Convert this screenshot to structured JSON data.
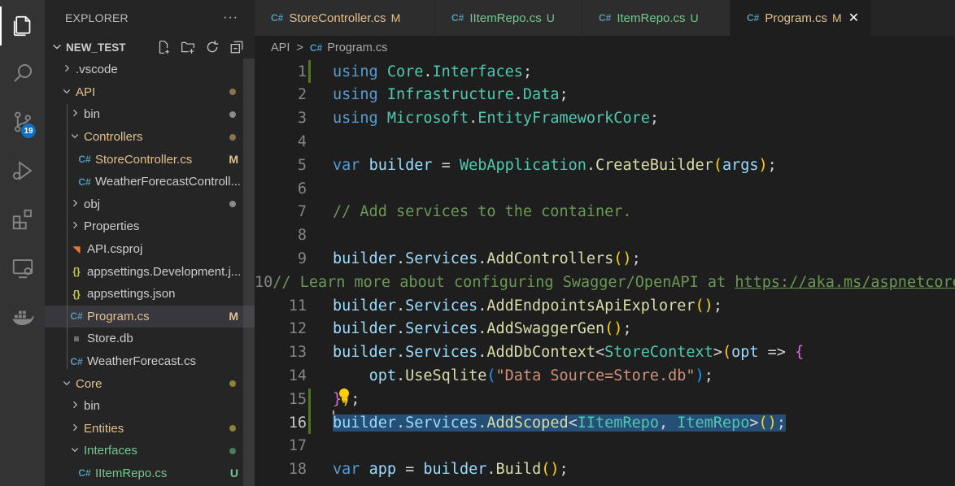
{
  "activity_bar": {
    "items": [
      {
        "icon": "explorer-icon"
      },
      {
        "icon": "search-icon"
      },
      {
        "icon": "source-control-icon",
        "badge": "19"
      },
      {
        "icon": "run-debug-icon"
      },
      {
        "icon": "extensions-icon"
      },
      {
        "icon": "remote-explorer-icon"
      },
      {
        "icon": "docker-icon"
      }
    ]
  },
  "sidebar": {
    "title": "EXPLORER",
    "more": "···",
    "project": "NEW_TEST",
    "tree": [
      {
        "label": ".vscode",
        "type": "folder",
        "expanded": false,
        "color": "#cccccc"
      },
      {
        "label": "API",
        "type": "folder",
        "expanded": true,
        "color": "#e2c08d",
        "marker": "dot",
        "marker_color": "#8a7453"
      },
      {
        "label": "bin",
        "type": "folder",
        "expanded": false,
        "color": "#cccccc",
        "marker": "dot",
        "marker_color": "#8b8b8b"
      },
      {
        "label": "Controllers",
        "type": "folder",
        "expanded": true,
        "color": "#e2c08d",
        "marker": "dot",
        "marker_color": "#8a7453"
      },
      {
        "label": "StoreController.cs",
        "type": "cs",
        "color": "#e2c08d",
        "status": "M"
      },
      {
        "label": "WeatherForecastControll...",
        "type": "cs",
        "color": "#cccccc"
      },
      {
        "label": "obj",
        "type": "folder",
        "expanded": false,
        "color": "#cccccc",
        "marker": "dot",
        "marker_color": "#8b8b8b"
      },
      {
        "label": "Properties",
        "type": "folder",
        "expanded": false,
        "color": "#cccccc"
      },
      {
        "label": "API.csproj",
        "type": "rss",
        "color": "#cccccc"
      },
      {
        "label": "appsettings.Development.j...",
        "type": "json",
        "color": "#cccccc"
      },
      {
        "label": "appsettings.json",
        "type": "json",
        "color": "#cccccc"
      },
      {
        "label": "Program.cs",
        "type": "cs",
        "color": "#e2c08d",
        "status": "M",
        "selected": true
      },
      {
        "label": "Store.db",
        "type": "db",
        "color": "#cccccc"
      },
      {
        "label": "WeatherForecast.cs",
        "type": "cs",
        "color": "#cccccc"
      },
      {
        "label": "Core",
        "type": "folder",
        "expanded": true,
        "color": "#e2c08d",
        "marker": "dot",
        "marker_color": "#8d8338"
      },
      {
        "label": "bin",
        "type": "folder",
        "expanded": false,
        "color": "#cccccc"
      },
      {
        "label": "Entities",
        "type": "folder",
        "expanded": false,
        "color": "#e2c08d",
        "marker": "dot",
        "marker_color": "#8d8338"
      },
      {
        "label": "Interfaces",
        "type": "folder",
        "expanded": true,
        "color": "#73c991",
        "marker": "dot",
        "marker_color": "#4a7d5b"
      },
      {
        "label": "IItemRepo.cs",
        "type": "cs",
        "color": "#73c991",
        "status": "U"
      }
    ]
  },
  "tabs": [
    {
      "label": "StoreController.cs",
      "status": "M",
      "active": false
    },
    {
      "label": "IItemRepo.cs",
      "status": "U",
      "active": false
    },
    {
      "label": "ItemRepo.cs",
      "status": "U",
      "active": false
    },
    {
      "label": "Program.cs",
      "status": "M",
      "active": true,
      "close": "✕"
    }
  ],
  "breadcrumb": {
    "folder": "API",
    "separator": ">",
    "file": "Program.cs"
  },
  "editor": {
    "current_line": 16,
    "lines": [
      {
        "n": "1",
        "tokens": [
          [
            "kw",
            "using"
          ],
          [
            "",
            "&nbsp;"
          ],
          [
            "ty",
            "Core"
          ],
          [
            "",
            "."
          ],
          [
            "ty",
            "Interfaces"
          ],
          [
            "",
            ";"
          ]
        ]
      },
      {
        "n": "2",
        "tokens": [
          [
            "kw",
            "using"
          ],
          [
            "",
            ""
          ],
          [
            "ty",
            "Infrastructure"
          ],
          [
            "",
            "."
          ],
          [
            "ty",
            "Data"
          ],
          [
            "",
            ";"
          ]
        ]
      },
      {
        "n": "3",
        "tokens": [
          [
            "kw",
            "using"
          ],
          [
            "",
            ""
          ],
          [
            "ty",
            "Microsoft"
          ],
          [
            "",
            "."
          ],
          [
            "ty",
            "EntityFrameworkCore"
          ],
          [
            "",
            ";"
          ]
        ]
      },
      {
        "n": "4",
        "tokens": []
      },
      {
        "n": "5",
        "tokens": [
          [
            "kw",
            "var"
          ],
          [
            "",
            ""
          ],
          [
            "va",
            "builder"
          ],
          [
            "",
            " = "
          ],
          [
            "ty",
            "WebApplication"
          ],
          [
            "",
            "."
          ],
          [
            "fn",
            "CreateBuilder"
          ],
          [
            "p1",
            "("
          ],
          [
            "va",
            "args"
          ],
          [
            "p1",
            ")"
          ],
          [
            "",
            ";"
          ]
        ]
      },
      {
        "n": "6",
        "tokens": []
      },
      {
        "n": "7",
        "tokens": [
          [
            "cm",
            "// Add services to the container."
          ]
        ]
      },
      {
        "n": "8",
        "tokens": []
      },
      {
        "n": "9",
        "tokens": [
          [
            "va",
            "builder"
          ],
          [
            "",
            "."
          ],
          [
            "va",
            "Services"
          ],
          [
            "",
            "."
          ],
          [
            "fn",
            "AddControllers"
          ],
          [
            "p1",
            "()"
          ],
          [
            "",
            ";"
          ]
        ]
      },
      {
        "n": "10",
        "tokens": [
          [
            "cm",
            "// Learn more about configuring Swagger/OpenAPI at "
          ],
          [
            "cm url",
            "https://aka.ms/aspnetcore/swashbuckle"
          ]
        ]
      },
      {
        "n": "11",
        "tokens": [
          [
            "va",
            "builder"
          ],
          [
            "",
            "."
          ],
          [
            "va",
            "Services"
          ],
          [
            "",
            "."
          ],
          [
            "fn",
            "AddEndpointsApiExplorer"
          ],
          [
            "p1",
            "()"
          ],
          [
            "",
            ";"
          ]
        ]
      },
      {
        "n": "12",
        "tokens": [
          [
            "va",
            "builder"
          ],
          [
            "",
            "."
          ],
          [
            "va",
            "Services"
          ],
          [
            "",
            "."
          ],
          [
            "fn",
            "AddSwaggerGen"
          ],
          [
            "p1",
            "()"
          ],
          [
            "",
            ";"
          ]
        ]
      },
      {
        "n": "13",
        "tokens": [
          [
            "va",
            "builder"
          ],
          [
            "",
            "."
          ],
          [
            "va",
            "Services"
          ],
          [
            "",
            "."
          ],
          [
            "fn",
            "AddDbContext"
          ],
          [
            "",
            "<"
          ],
          [
            "ty",
            "StoreContext"
          ],
          [
            "",
            ">"
          ],
          [
            "p1",
            "("
          ],
          [
            "va",
            "opt"
          ],
          [
            "",
            " => "
          ],
          [
            "p2",
            "{"
          ]
        ]
      },
      {
        "n": "14",
        "tokens": [
          [
            "",
            "    "
          ],
          [
            "va",
            "opt"
          ],
          [
            "",
            "."
          ],
          [
            "fn",
            "UseSqlite"
          ],
          [
            "p3",
            "("
          ],
          [
            "st",
            "\"Data Source=Store.db\""
          ],
          [
            "p3",
            ")"
          ],
          [
            "",
            ";"
          ]
        ]
      },
      {
        "n": "15",
        "tokens": [
          [
            "p2",
            "}"
          ],
          [
            "p1",
            ")"
          ],
          [
            "",
            ";"
          ]
        ]
      },
      {
        "n": "16",
        "tokens": [
          [
            "va",
            "builder"
          ],
          [
            "",
            "."
          ],
          [
            "va",
            "Services"
          ],
          [
            "",
            "."
          ],
          [
            "fn",
            "AddScoped"
          ],
          [
            "",
            "<"
          ],
          [
            "ty",
            "IItemRepo"
          ],
          [
            "",
            ", "
          ],
          [
            "ty",
            "ItemRepo"
          ],
          [
            "",
            ">"
          ],
          [
            "p1",
            "()"
          ],
          [
            "",
            ";"
          ]
        ],
        "highlight": true
      },
      {
        "n": "17",
        "tokens": []
      },
      {
        "n": "18",
        "tokens": [
          [
            "kw",
            "var"
          ],
          [
            "",
            ""
          ],
          [
            "va",
            "app"
          ],
          [
            "",
            " = "
          ],
          [
            "va",
            "builder"
          ],
          [
            "",
            "."
          ],
          [
            "fn",
            "Build"
          ],
          [
            "p1",
            "()"
          ],
          [
            "",
            ";"
          ]
        ]
      }
    ]
  }
}
